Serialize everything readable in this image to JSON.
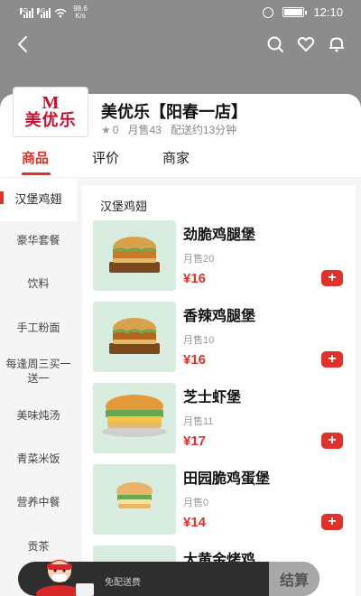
{
  "status_bar": {
    "signal_1_tag": "4G",
    "signal_2_tag": "4G",
    "net_speed_value": "98.6",
    "net_speed_unit": "K/s",
    "time": "12:10"
  },
  "store": {
    "logo_mark": "M",
    "logo_text": "美优乐",
    "name": "美优乐【阳春一店】",
    "rating": "0",
    "monthly_sales": "月售43",
    "delivery_time": "配送约13分钟"
  },
  "tabs": [
    {
      "label": "商品",
      "active": true
    },
    {
      "label": "评价",
      "active": false
    },
    {
      "label": "商家",
      "active": false
    }
  ],
  "sidebar": {
    "items": [
      {
        "label": "汉堡鸡翅",
        "active": true
      },
      {
        "label": "豪华套餐"
      },
      {
        "label": "饮料"
      },
      {
        "label": "手工粉面"
      },
      {
        "label": "每逢周三买一送一"
      },
      {
        "label": "美味炖汤"
      },
      {
        "label": "青菜米饭"
      },
      {
        "label": "营养中餐"
      },
      {
        "label": "贡茶"
      }
    ]
  },
  "section_title": "汉堡鸡翅",
  "products": [
    {
      "name": "劲脆鸡腿堡",
      "sales": "月售20",
      "price": "¥16",
      "icon": "crispy-chicken-burger"
    },
    {
      "name": "香辣鸡腿堡",
      "sales": "月售10",
      "price": "¥16",
      "icon": "spicy-chicken-burger"
    },
    {
      "name": "芝士虾堡",
      "sales": "月售11",
      "price": "¥17",
      "icon": "cheese-shrimp-burger"
    },
    {
      "name": "田园脆鸡蛋堡",
      "sales": "月售0",
      "price": "¥14",
      "icon": "garden-egg-burger"
    },
    {
      "name": "大黄金烤鸡",
      "sales": "",
      "price": "",
      "icon": "roast-chicken"
    }
  ],
  "add_button_label": "+",
  "cart": {
    "delivery_text": "免配送费",
    "checkout_label": "结算"
  },
  "colors": {
    "accent": "#e0312b",
    "header_bg": "#8c8c8c",
    "cart_bg": "#2e2e2e"
  }
}
